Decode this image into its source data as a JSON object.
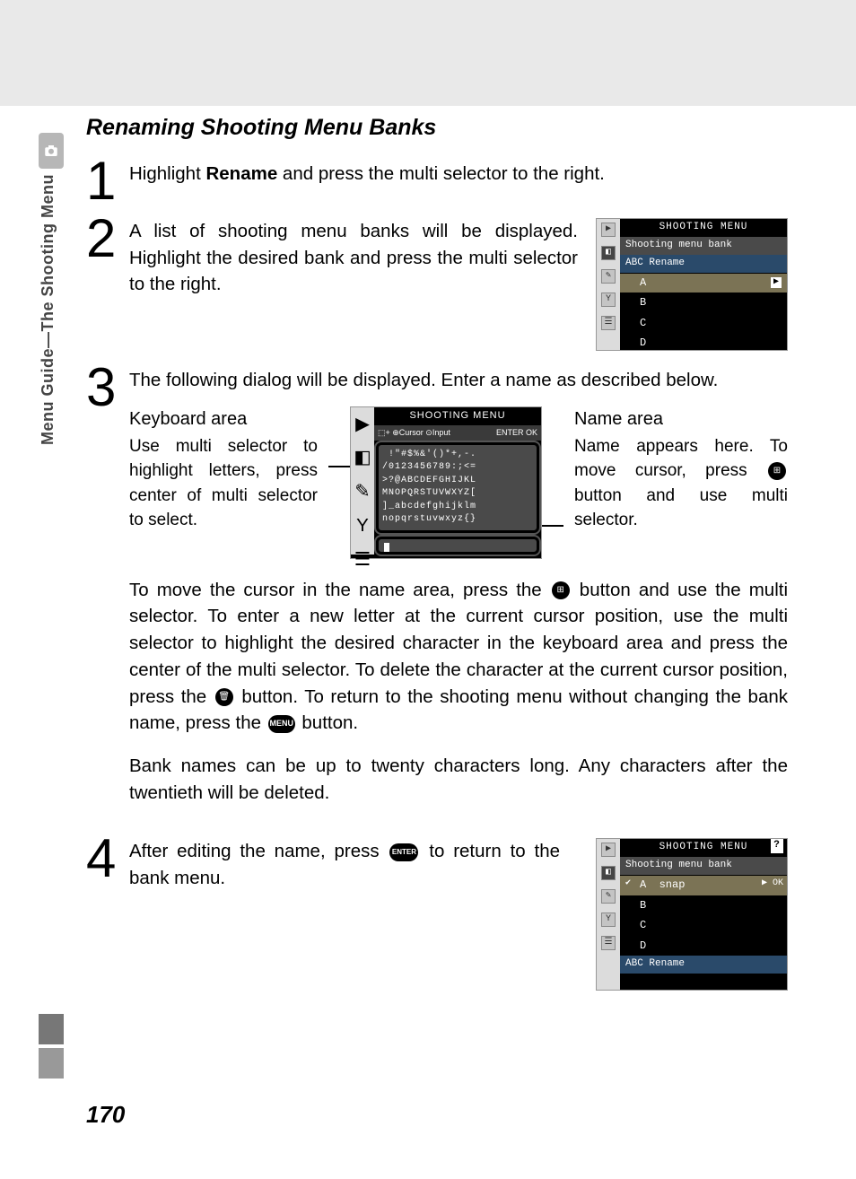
{
  "sidebar": {
    "label": "Menu Guide—The Shooting Menu"
  },
  "section_title": "Renaming Shooting Menu Banks",
  "steps": {
    "s1": {
      "num": "1",
      "pre": "Highlight ",
      "bold": "Rename",
      "post": " and press the multi selector to the right."
    },
    "s2": {
      "num": "2",
      "text": "A list of shooting menu banks will be displayed.  Highlight the desired bank and press the multi selector to the right."
    },
    "s3": {
      "num": "3",
      "lead": "The following dialog will be displayed.  Enter a name as described below.",
      "keyboard_area_title": "Keyboard area",
      "keyboard_area_text": "Use multi selector to highlight letters, press center of multi selector to select.",
      "name_area_title": "Name area",
      "name_area_text_pre": "Name appears here.  To move cursor, press ",
      "name_area_text_post": " button and use multi selector.",
      "para1_pre": "To move the cursor in the name area, press the ",
      "para1_mid1": " button and use the multi selector.  To enter a new letter at the current cursor position, use the multi selector to highlight the desired character in the keyboard area and press the center of the multi selector.  To delete the character at the current cursor position, press the ",
      "para1_mid2": " button.  To return to the shooting menu without changing the bank name, press the ",
      "para1_post": " button.",
      "para2": "Bank names can be up to twenty characters long.  Any characters after the twentieth will be deleted."
    },
    "s4": {
      "num": "4",
      "pre": "After editing the name, press ",
      "post": " to return to the bank menu."
    }
  },
  "lcd": {
    "title": "SHOOTING MENU",
    "subtitle": "Shooting menu bank",
    "rename_label": "ABC Rename",
    "banks": [
      "A",
      "B",
      "C",
      "D"
    ],
    "help_icon": "?",
    "ok": "OK",
    "snap": "snap",
    "kbd_hint_left": "⬚+ ⊕Cursor ⊙Input",
    "kbd_hint_right": "ENTER OK",
    "kbd_lines": [
      " !\"#$%&'()*+,-.",
      "/0123456789:;<=",
      ">?@ABCDEFGHIJKL",
      "MNOPQRSTUVWXYZ[",
      "]_abcdefghijklm",
      "nopqrstuvwxyz{}"
    ]
  },
  "icons": {
    "thumb": "⊞",
    "trash": "🗑",
    "menu": "MENU",
    "enter": "ENTER"
  },
  "page_number": "170"
}
